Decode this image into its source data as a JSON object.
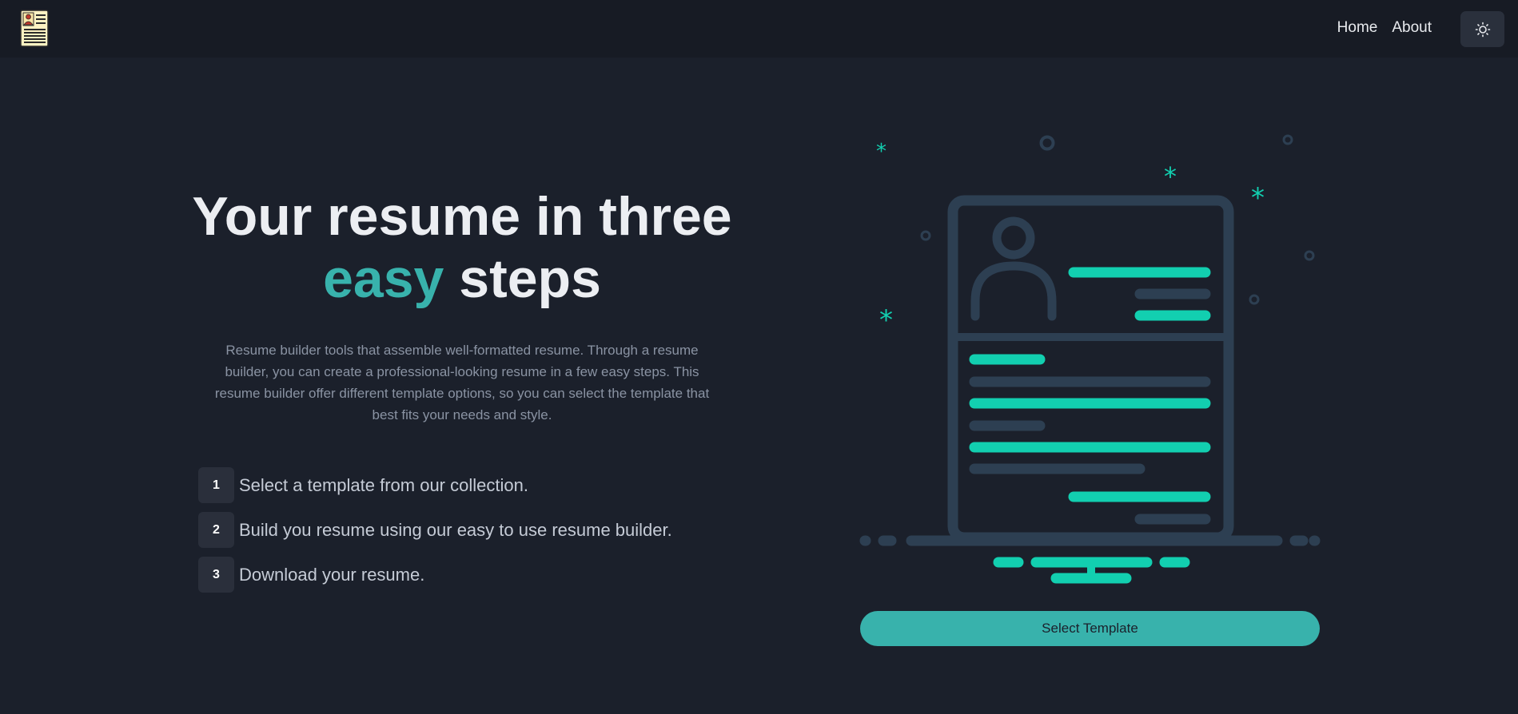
{
  "nav": {
    "home": "Home",
    "about": "About"
  },
  "hero": {
    "title_line1": "Your resume in three",
    "title_accent": "easy",
    "title_rest": " steps",
    "description": "Resume builder tools that assemble well-formatted resume. Through a resume builder, you can create a professional-looking resume in a few easy steps. This resume builder offer different template options, so you can select the template that best fits your needs and style."
  },
  "steps": [
    {
      "num": "1",
      "text": "Select a template from our collection."
    },
    {
      "num": "2",
      "text": "Build you resume using our easy to use resume builder."
    },
    {
      "num": "3",
      "text": "Download your resume."
    }
  ],
  "cta": {
    "label": "Select Template"
  },
  "colors": {
    "accent": "#38b2ac",
    "background": "#1b202b",
    "navbar": "#171b24",
    "illustration_line": "#2d3f52",
    "illustration_highlight": "#12cfb0"
  },
  "icons": {
    "logo": "resume-document-logo-icon",
    "theme": "sun-icon"
  }
}
